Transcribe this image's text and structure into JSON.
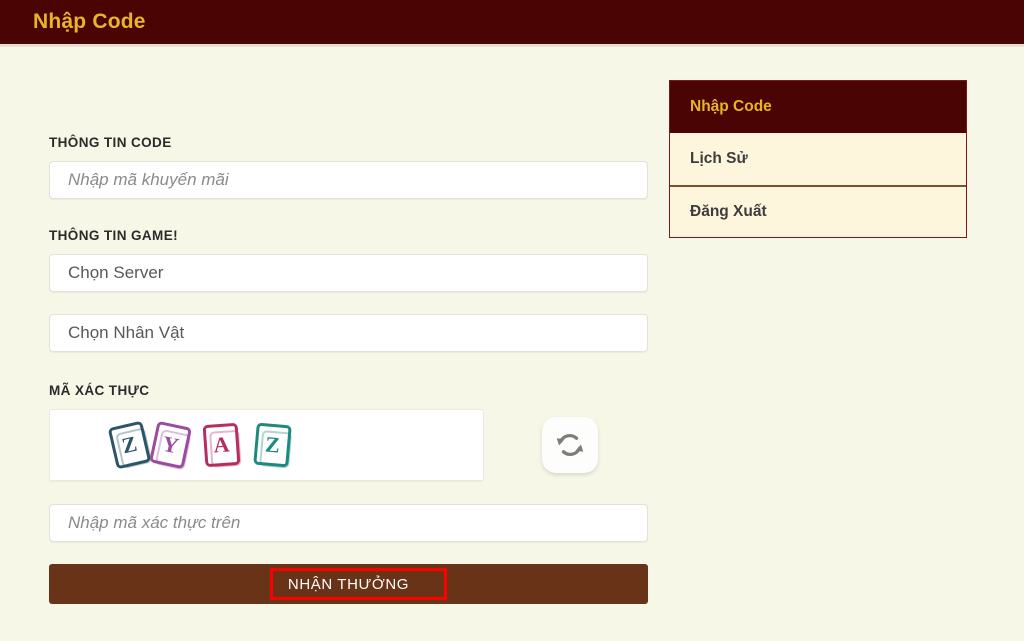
{
  "header": {
    "title": "Nhập Code",
    "bg_color": "#4a0404",
    "text_color": "#e9b425"
  },
  "form": {
    "code_section": {
      "label": "THÔNG TIN CODE",
      "input": {
        "name": "promo-code-input",
        "value": "",
        "placeholder": "Nhập mã khuyến mãi"
      }
    },
    "game_section": {
      "label": "THÔNG TIN GAME!",
      "server_select": {
        "name": "server-select",
        "value": "Chọn Server"
      },
      "character_select": {
        "name": "character-select",
        "value": "Chọn Nhân Vật"
      }
    },
    "captcha_section": {
      "label": "MÃ XÁC THỰC",
      "characters": [
        {
          "char": "Z",
          "color": "#2c5565"
        },
        {
          "char": "Y",
          "color": "#9c4b9e"
        },
        {
          "char": "A",
          "color": "#b82d61"
        },
        {
          "char": "Z",
          "color": "#1e8a7e"
        }
      ],
      "code": "ZYAZ",
      "refresh_icon": "refresh-icon",
      "input": {
        "name": "captcha-input",
        "value": "",
        "placeholder": "Nhập mã xác thực trên"
      }
    },
    "submit": {
      "label": "NHẬN THƯỞNG",
      "bg_color": "#693318",
      "highlight_color": "#fe0000"
    }
  },
  "sidebar": {
    "items": [
      {
        "label": "Nhập Code",
        "active": true
      },
      {
        "label": "Lịch Sử",
        "active": false
      },
      {
        "label": "Đăng Xuất",
        "active": false
      }
    ]
  }
}
